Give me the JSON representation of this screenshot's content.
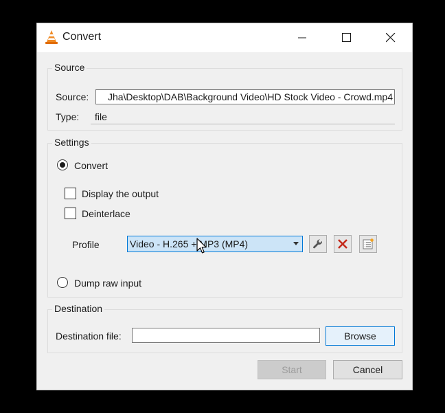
{
  "window": {
    "title": "Convert",
    "controls": {
      "minimize": "minimize",
      "maximize": "maximize",
      "close": "close"
    }
  },
  "source": {
    "group_title": "Source",
    "source_label": "Source:",
    "source_value": "Jha\\Desktop\\DAB\\Background Video\\HD Stock Video - Crowd.mp4",
    "type_label": "Type:",
    "type_value": "file"
  },
  "settings": {
    "group_title": "Settings",
    "convert_label": "Convert",
    "convert_selected": true,
    "display_output_label": "Display the output",
    "display_output_checked": false,
    "deinterlace_label": "Deinterlace",
    "deinterlace_checked": false,
    "profile_label": "Profile",
    "profile_value": "Video - H.265 + MP3 (MP4)",
    "profile_tools": [
      "wrench-icon",
      "delete-icon",
      "new-profile-icon"
    ],
    "dump_raw_label": "Dump raw input",
    "dump_raw_selected": false
  },
  "destination": {
    "group_title": "Destination",
    "file_label": "Destination file:",
    "file_value": "",
    "browse_label": "Browse"
  },
  "footer": {
    "start_label": "Start",
    "start_enabled": false,
    "cancel_label": "Cancel"
  },
  "colors": {
    "accent": "#0078d7",
    "selection": "#cce4f7",
    "delete_red": "#c42b1c"
  }
}
